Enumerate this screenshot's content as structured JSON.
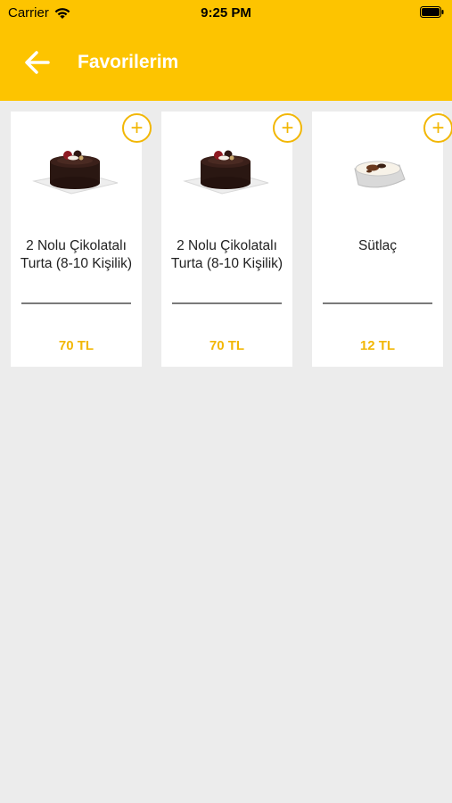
{
  "status_bar": {
    "carrier": "Carrier",
    "time": "9:25 PM"
  },
  "header": {
    "title": "Favorilerim",
    "background": "#fdc400"
  },
  "accent_color": "#f2b705",
  "products": [
    {
      "name": "2 Nolu Çikolatalı Turta (8-10 Kişilik)",
      "price": "70 TL",
      "image": "chocolate-cake"
    },
    {
      "name": "2 Nolu Çikolatalı Turta (8-10 Kişilik)",
      "price": "70 TL",
      "image": "chocolate-cake"
    },
    {
      "name": "Sütlaç",
      "price": "12 TL",
      "image": "rice-pudding"
    }
  ],
  "add_button_symbol": "+"
}
